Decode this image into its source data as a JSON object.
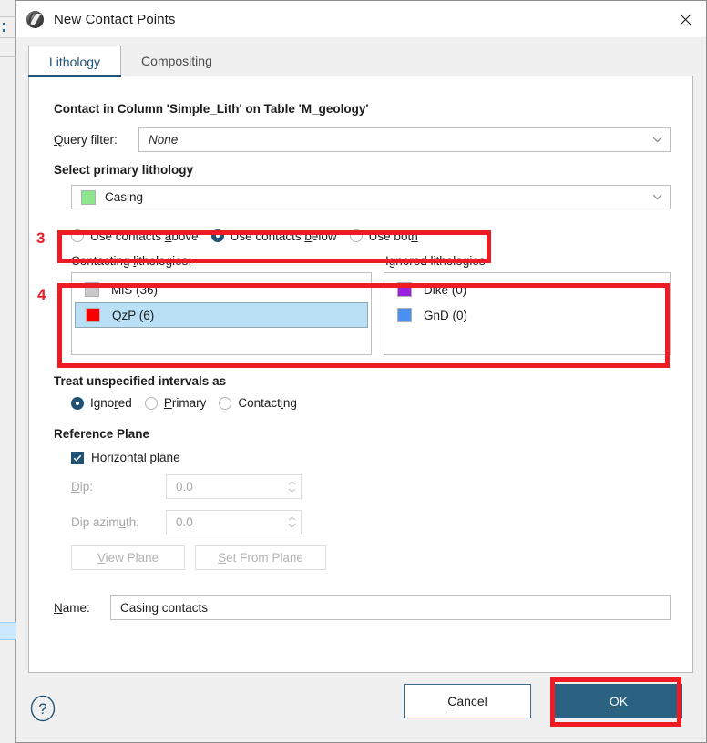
{
  "window": {
    "title": "New Contact Points",
    "icon": "app-logo-icon",
    "close_icon": "close-icon"
  },
  "tabs": [
    {
      "label": "Lithology",
      "active": true
    },
    {
      "label": "Compositing",
      "active": false
    }
  ],
  "main": {
    "contact_heading": "Contact in Column 'Simple_Lith' on Table 'M_geology'",
    "query_filter": {
      "label_pre": "Q",
      "label_accel": "u",
      "label_post": "ery filter:",
      "value": "None"
    },
    "primary_lithology": {
      "heading": "Select primary lithology",
      "value": "Casing",
      "swatch_color": "#8ce68c"
    },
    "contact_direction": {
      "options": [
        {
          "pre": "Use contacts ",
          "accel": "a",
          "post": "bove",
          "checked": false
        },
        {
          "pre": "Use contacts ",
          "accel": "b",
          "post": "elow",
          "checked": true
        },
        {
          "pre": "Use bot",
          "accel": "h",
          "post": "",
          "checked": false
        }
      ],
      "option_both_prefix": "Use bot"
    },
    "contacting": {
      "label_pre": "Contacting ",
      "label_accel": "l",
      "label_post": "ithologies:",
      "items": [
        {
          "label": "MiS (36)",
          "color": "#c8c8c8",
          "selected": false
        },
        {
          "label": "QzP (6)",
          "color": "#f90000",
          "selected": true
        }
      ]
    },
    "ignored": {
      "label": "Ignored lithologies:",
      "items": [
        {
          "label": "Dike (0)",
          "color": "#9b1fe0",
          "selected": false
        },
        {
          "label": "GnD (0)",
          "color": "#4a90f0",
          "selected": false
        }
      ]
    },
    "unspecified": {
      "heading": "Treat unspecified intervals as",
      "options": [
        {
          "pre": "Igno",
          "accel": "r",
          "post": "ed",
          "checked": true
        },
        {
          "pre": "",
          "accel": "P",
          "post": "rimary",
          "checked": false
        },
        {
          "pre": "Contact",
          "accel": "i",
          "post": "ng",
          "checked": false
        }
      ]
    },
    "reference_plane": {
      "heading": "Reference Plane",
      "horizontal": {
        "pre": "Hori",
        "accel": "z",
        "post": "ontal plane",
        "checked": true
      },
      "dip": {
        "pre": "",
        "accel": "D",
        "post": "ip:",
        "value": "0.0",
        "disabled": true
      },
      "dip_azimuth": {
        "pre": "Dip azim",
        "accel": "u",
        "post": "th:",
        "value": "0.0",
        "disabled": true
      },
      "view_plane": {
        "pre": "",
        "accel": "V",
        "post": "iew Plane",
        "disabled": true
      },
      "set_from_plane": {
        "pre": "",
        "accel": "S",
        "post": "et From Plane",
        "disabled": true
      }
    },
    "name_field": {
      "label_pre": "",
      "label_accel": "N",
      "label_post": "ame:",
      "value": "Casing contacts"
    }
  },
  "footer": {
    "help_icon": "help-question-icon",
    "cancel": {
      "pre": "",
      "accel": "C",
      "post": "ancel"
    },
    "ok": {
      "pre": "",
      "accel": "O",
      "post": "K"
    }
  },
  "annotations": [
    {
      "number": "3"
    },
    {
      "number": "4"
    },
    {
      "number": ""
    }
  ],
  "colors": {
    "accent": "#1f5274",
    "ok_button": "#2b6181",
    "annotation_red": "#ee1b24",
    "selection_blue": "#b9e0f5"
  }
}
